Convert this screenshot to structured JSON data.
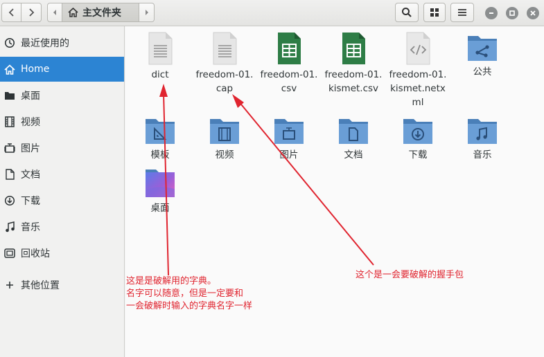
{
  "header": {
    "location": "主文件夹",
    "icons": [
      "back-icon",
      "forward-icon",
      "home-icon",
      "search-icon",
      "grid-view-icon",
      "menu-icon",
      "minimize-icon",
      "maximize-icon",
      "close-icon"
    ]
  },
  "sidebar": {
    "items": [
      {
        "label": "最近使用的",
        "icon": "recent-icon"
      },
      {
        "label": "Home",
        "icon": "home-icon",
        "active": true
      },
      {
        "label": "桌面",
        "icon": "desktop-folder-icon"
      },
      {
        "label": "视频",
        "icon": "video-icon"
      },
      {
        "label": "图片",
        "icon": "picture-icon"
      },
      {
        "label": "文档",
        "icon": "document-icon"
      },
      {
        "label": "下载",
        "icon": "download-icon"
      },
      {
        "label": "音乐",
        "icon": "music-icon"
      },
      {
        "label": "回收站",
        "icon": "trash-icon"
      },
      {
        "label": "其他位置",
        "icon": "plus-icon"
      }
    ]
  },
  "files": [
    {
      "name": "dict",
      "icon": "text-file-icon"
    },
    {
      "name": "freedom-01.cap",
      "icon": "text-file-icon"
    },
    {
      "name": "freedom-01.csv",
      "icon": "spreadsheet-icon"
    },
    {
      "name": "freedom-01.kismet.csv",
      "icon": "spreadsheet-icon"
    },
    {
      "name": "freedom-01.kismet.netxml",
      "icon": "xml-file-icon"
    },
    {
      "name": "公共",
      "icon": "shared-folder-icon"
    },
    {
      "name": "模板",
      "icon": "templates-folder-icon"
    },
    {
      "name": "视频",
      "icon": "videos-folder-icon"
    },
    {
      "name": "图片",
      "icon": "pictures-folder-icon"
    },
    {
      "name": "文档",
      "icon": "documents-folder-icon"
    },
    {
      "name": "下载",
      "icon": "downloads-folder-icon"
    },
    {
      "name": "音乐",
      "icon": "music-folder-icon"
    },
    {
      "name": "桌面",
      "icon": "desktop-folder-icon"
    }
  ],
  "annotations": {
    "dict_note": [
      "这是是破解用的字典。",
      "名字可以随意，但是一定要和",
      "一会破解时输入的字典名字一样"
    ],
    "cap_note": "这个是一会要破解的握手包",
    "color": "#e0242f"
  },
  "colors": {
    "accent": "#2c84d3",
    "folder": "#5b8fc7",
    "spreadsheet": "#2e7d46"
  }
}
